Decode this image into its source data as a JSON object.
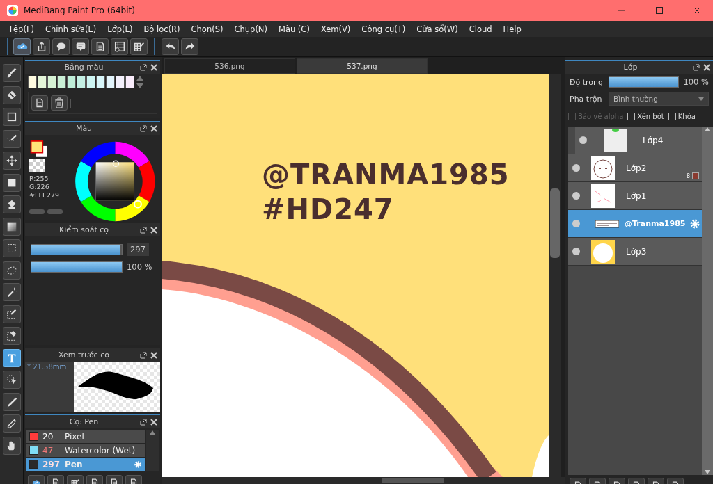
{
  "window": {
    "title": "MediBang Paint Pro (64bit)"
  },
  "menu": [
    "Tệp(F)",
    "Chỉnh sửa(E)",
    "Lớp(L)",
    "Bộ lọc(R)",
    "Chọn(S)",
    "Chụp(N)",
    "Màu (C)",
    "Xem(V)",
    "Công cụ(T)",
    "Cửa sổ(W)",
    "Cloud",
    "Help"
  ],
  "toolbar": [
    {
      "kind": "cloud",
      "selected": true
    },
    {
      "kind": "share",
      "selected": false
    },
    {
      "kind": "bubble",
      "selected": false
    },
    {
      "kind": "comment",
      "selected": false
    },
    {
      "kind": "page",
      "selected": false
    },
    {
      "kind": "list",
      "selected": false
    },
    {
      "kind": "grid",
      "selected": false
    },
    {
      "kind": "undo",
      "selected": false
    },
    {
      "kind": "redo",
      "selected": false
    }
  ],
  "tools": [
    {
      "kind": "brush",
      "selected": false
    },
    {
      "kind": "eraser",
      "selected": false
    },
    {
      "kind": "rect",
      "selected": false
    },
    {
      "kind": "polyline",
      "selected": false
    },
    {
      "kind": "move",
      "selected": false
    },
    {
      "kind": "fill",
      "selected": false
    },
    {
      "kind": "bucket",
      "selected": false
    },
    {
      "kind": "gradient",
      "selected": false
    },
    {
      "kind": "select",
      "selected": false
    },
    {
      "kind": "lasso",
      "selected": false
    },
    {
      "kind": "wand",
      "selected": false
    },
    {
      "kind": "selpen",
      "selected": false
    },
    {
      "kind": "selerase",
      "selected": false
    },
    {
      "kind": "text",
      "selected": true
    },
    {
      "kind": "operation",
      "selected": false
    },
    {
      "kind": "knife",
      "selected": false
    },
    {
      "kind": "dropper",
      "selected": false
    },
    {
      "kind": "hand",
      "selected": false
    }
  ],
  "palette": {
    "title": "Bảng màu",
    "swatches": [
      {
        "color": "#fffbe0"
      },
      {
        "color": "#e4f5d8"
      },
      {
        "color": "#d6f2d4"
      },
      {
        "color": "#c9efd5"
      },
      {
        "color": "#bfeed8"
      },
      {
        "color": "#c4f0e4"
      },
      {
        "color": "#cdf5f3"
      },
      {
        "color": "#d8f6fa"
      },
      {
        "color": "#e2f4fb"
      },
      {
        "color": "#f3f0fb"
      },
      {
        "color": "#f9ecfb"
      }
    ],
    "set_name": "---"
  },
  "color": {
    "title": "Màu",
    "r": "R:255",
    "g": "G:226",
    "hex": "#FFE279"
  },
  "brush_control": {
    "title": "Kiểm soát cọ",
    "size": {
      "level": 0.98,
      "reading": "297"
    },
    "opacity": {
      "level": 1,
      "reading": "100 %"
    }
  },
  "brush_preview": {
    "title": "Xem trước cọ",
    "size": "* 21.58mm"
  },
  "brushes": {
    "title": "Cọ: Pen",
    "items": [
      {
        "color": "#ff3b3b",
        "size": "20",
        "name": "Pixel",
        "selected": false
      },
      {
        "color": "#7fdcf5",
        "size": "47",
        "name": "Watercolor (Wet)",
        "selected": false
      },
      {
        "color": "#2a2a2a",
        "size": "297",
        "name": "Pen",
        "selected": true
      }
    ]
  },
  "tabs": [
    {
      "label": "536.png",
      "selected": false
    },
    {
      "label": "537.png",
      "selected": true
    }
  ],
  "canvas": {
    "lines": [
      "@TRANMA1985",
      "#HD247"
    ]
  },
  "layers": {
    "title": "Lớp",
    "opacity_label": "Độ trong",
    "opacity": {
      "level": 1,
      "reading": "100 %"
    },
    "blend_label": "Pha trộn",
    "blend": "Bình thường",
    "options": [
      {
        "label": "Bảo vệ alpha",
        "checked": false,
        "disabled": true
      },
      {
        "label": "Xén bớt",
        "checked": false,
        "disabled": false
      },
      {
        "label": "Khóa",
        "checked": false,
        "disabled": false
      }
    ],
    "items": [
      {
        "name": "Lớp4",
        "kind": "clip",
        "selected": false
      },
      {
        "name": "Lớp2",
        "kind": "normal",
        "selected": false,
        "badge": "8"
      },
      {
        "name": "Lớp1",
        "kind": "normal",
        "selected": false
      },
      {
        "name": "@Tranma1985",
        "kind": "text",
        "selected": true
      },
      {
        "name": "Lớp3",
        "kind": "normal",
        "selected": false
      }
    ]
  }
}
